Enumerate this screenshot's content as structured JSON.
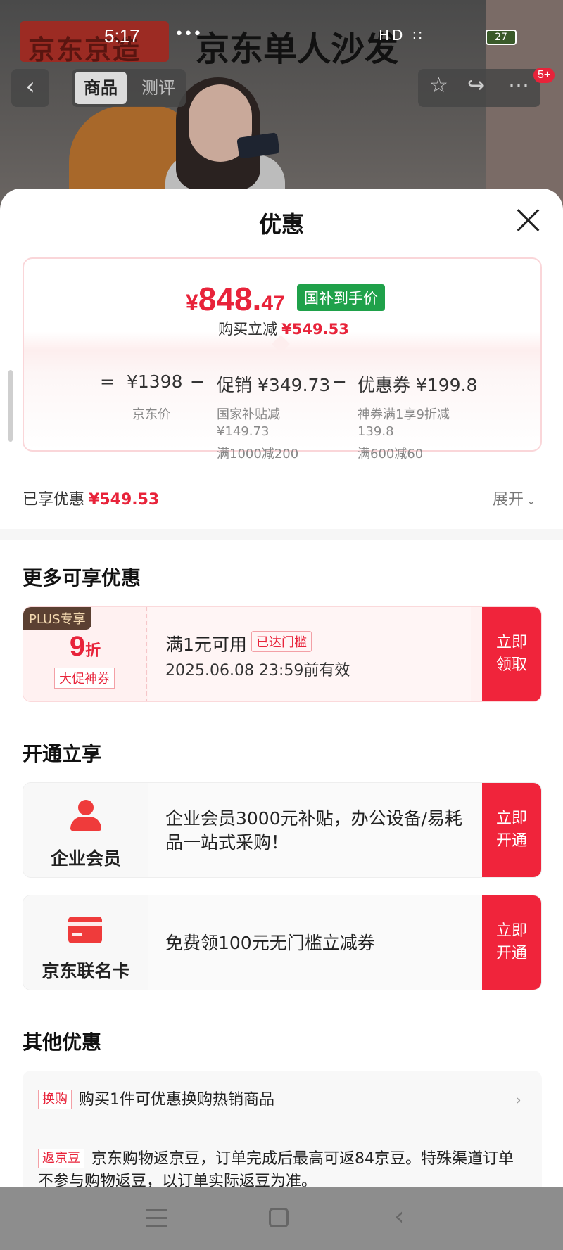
{
  "status_bar": {
    "time": "5:17",
    "dots": "•••",
    "icons_text": "HD ∷",
    "battery": "27"
  },
  "background": {
    "product_title": "京东单人沙发",
    "banner_text": "京东京造"
  },
  "top_nav": {
    "back_icon": "‹",
    "tabs": [
      {
        "label": "商品"
      },
      {
        "label": "测评"
      }
    ],
    "star_icon": "☆",
    "share_icon": "↪",
    "more_icon": "⋯",
    "badge": "5+"
  },
  "sheet": {
    "title": "优惠"
  },
  "price": {
    "currency": "¥",
    "integer": "848.",
    "decimal": "47",
    "tag": "国补到手价",
    "saved_label": "购买立减",
    "saved_value": "¥549.53"
  },
  "breakdown": {
    "eq": "=",
    "base_value": "¥1398",
    "base_label": "京东价",
    "minus": "−",
    "promo_value": "促销 ¥349.73",
    "promo_line1": "国家补贴减",
    "promo_line2": "¥149.73",
    "promo_line3": "满1000减200",
    "coupon_value": "优惠券 ¥199.8",
    "coupon_line1": "神券满1享9折减",
    "coupon_line2": "139.8",
    "coupon_line3": "满600减60"
  },
  "enjoyed": {
    "label": "已享优惠",
    "value": "¥549.53",
    "expand": "展开",
    "expand_icon": "⌵"
  },
  "more_offers": {
    "title": "更多可享优惠",
    "coupon": {
      "badge": "PLUS专享",
      "discount_num": "9",
      "discount_unit": "折",
      "kind": "大促神券",
      "condition": "满1元可用",
      "state": "已达门槛",
      "validity": "2025.06.08 23:59前有效",
      "action_line1": "立即",
      "action_line2": "领取"
    }
  },
  "open_enjoy": {
    "title": "开通立享",
    "items": [
      {
        "label": "企业会员",
        "text": " 企业会员3000元补贴，办公设备/易耗品一站式采购！",
        "action_line1": "立即",
        "action_line2": "开通"
      },
      {
        "label": "京东联名卡",
        "text": "免费领100元无门槛立减券",
        "action_line1": "立即",
        "action_line2": "开通"
      }
    ]
  },
  "other_offers": {
    "title": "其他优惠",
    "items": [
      {
        "tag": "换购",
        "text": "购买1件可优惠换购热销商品",
        "chevron": "›"
      },
      {
        "tag": "返京豆",
        "text": "京东购物返京豆，订单完成后最高可返84京豆。特殊渠道订单不参与购物返豆，以订单实际返豆为准。"
      }
    ]
  },
  "colors": {
    "accent_red": "#e8233a",
    "button_red": "#f0243b",
    "green_tag": "#1fa14a",
    "plus_brown": "#5b4032"
  }
}
